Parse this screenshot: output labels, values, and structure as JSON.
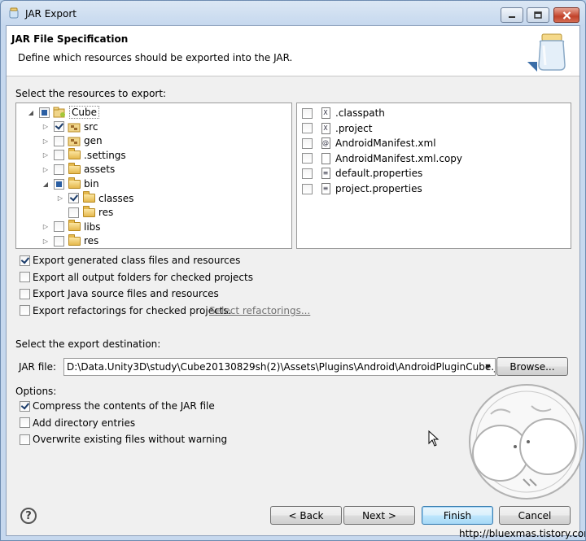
{
  "window": {
    "title": "JAR Export"
  },
  "header": {
    "title": "JAR File Specification",
    "description": "Define which resources should be exported into the JAR."
  },
  "resources": {
    "label": "Select the resources to export:",
    "tree": [
      {
        "label": "Cube",
        "check": "partial",
        "expander": "expanded",
        "icon": "project-icon",
        "level": 0
      },
      {
        "label": "src",
        "check": "checked",
        "expander": "collapsed",
        "icon": "package-folder-icon",
        "level": 1
      },
      {
        "label": "gen",
        "check": "none",
        "expander": "collapsed",
        "icon": "package-folder-icon",
        "level": 1
      },
      {
        "label": ".settings",
        "check": "none",
        "expander": "collapsed",
        "icon": "folder-icon",
        "level": 1
      },
      {
        "label": "assets",
        "check": "none",
        "expander": "collapsed",
        "icon": "folder-icon",
        "level": 1
      },
      {
        "label": "bin",
        "check": "partial",
        "expander": "expanded",
        "icon": "folder-icon",
        "level": 1
      },
      {
        "label": "classes",
        "check": "checked",
        "expander": "collapsed",
        "icon": "folder-icon",
        "level": 2
      },
      {
        "label": "res",
        "check": "none",
        "expander": "none",
        "icon": "folder-icon",
        "level": 2
      },
      {
        "label": "libs",
        "check": "none",
        "expander": "collapsed",
        "icon": "folder-icon",
        "level": 1
      },
      {
        "label": "res",
        "check": "none",
        "expander": "collapsed",
        "icon": "folder-icon",
        "level": 1
      }
    ],
    "files": [
      {
        "label": ".classpath",
        "checked": false,
        "icon": "xml-file-icon",
        "glyph": "X"
      },
      {
        "label": ".project",
        "checked": false,
        "icon": "xml-file-icon",
        "glyph": "X"
      },
      {
        "label": "AndroidManifest.xml",
        "checked": false,
        "icon": "android-manifest-icon",
        "glyph": "@"
      },
      {
        "label": "AndroidManifest.xml.copy",
        "checked": false,
        "icon": "text-file-icon",
        "glyph": ""
      },
      {
        "label": "default.properties",
        "checked": false,
        "icon": "properties-file-icon",
        "glyph": "≡"
      },
      {
        "label": "project.properties",
        "checked": false,
        "icon": "properties-file-icon",
        "glyph": "≡"
      }
    ]
  },
  "export_options": [
    {
      "label": "Export generated class files and resources",
      "checked": true
    },
    {
      "label": "Export all output folders for checked projects",
      "checked": false
    },
    {
      "label": "Export Java source files and resources",
      "checked": false
    },
    {
      "label": "Export refactorings for checked projects.",
      "checked": false
    }
  ],
  "select_refactorings_link": "Select refactorings...",
  "destination": {
    "label": "Select the export destination:",
    "jar_label": "JAR file:",
    "jar_path": "D:\\Data.Unity3D\\study\\Cube20130829sh(2)\\Assets\\Plugins\\Android\\AndroidPluginCube.jar",
    "browse_label": "Browse..."
  },
  "options": {
    "label": "Options:",
    "items": [
      {
        "label": "Compress the contents of the JAR file",
        "checked": true
      },
      {
        "label": "Add directory entries",
        "checked": false
      },
      {
        "label": "Overwrite existing files without warning",
        "checked": false
      }
    ]
  },
  "buttons": {
    "back": "< Back",
    "next": "Next >",
    "finish": "Finish",
    "cancel": "Cancel"
  },
  "watermark_url": "http://bluexmas.tistory.com"
}
